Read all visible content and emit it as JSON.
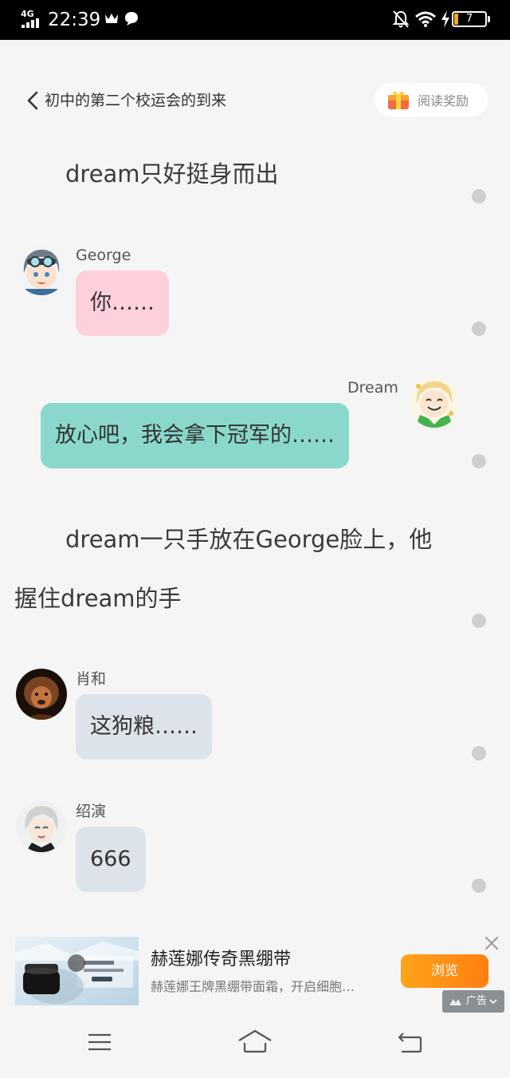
{
  "status_bar": {
    "network": "4G",
    "time": "22:39",
    "battery_level": "7",
    "icons": [
      "signal-icon",
      "crown-icon",
      "message-bubble-icon",
      "bell-off-icon",
      "wifi-icon",
      "charging-bolt-icon",
      "battery-icon"
    ]
  },
  "header": {
    "title": "初中的第二个校运会的到来",
    "reward_label": "阅读奖励",
    "icons": [
      "back-chevron-icon",
      "gift-box-icon"
    ]
  },
  "story": [
    {
      "type": "narration",
      "text": "dream只好挺身而出"
    },
    {
      "type": "message",
      "side": "left",
      "speaker": "George",
      "text": "你……",
      "bubble_color": "#fdd0dc"
    },
    {
      "type": "message",
      "side": "right",
      "speaker": "Dream",
      "text": "放心吧，我会拿下冠军的……",
      "bubble_color": "#8ad8cb"
    },
    {
      "type": "narration",
      "line1": "dream一只手放在George脸上，他",
      "line2": "握住dream的手"
    },
    {
      "type": "message",
      "side": "left",
      "speaker": "肖和",
      "text": "这狗粮……",
      "bubble_color": "#dde3ea"
    },
    {
      "type": "message",
      "side": "left",
      "speaker": "绍演",
      "text": "666",
      "bubble_color": "#dde3ea"
    }
  ],
  "ad": {
    "title": "赫莲娜传奇黑绷带",
    "description": "赫莲娜王牌黑绷带面霜，开启细胞…",
    "button_label": "浏览",
    "tag_label": "广告",
    "button_color": "#ff8f14"
  },
  "nav_bar": {
    "icons": [
      "menu-icon",
      "home-icon",
      "back-icon"
    ]
  }
}
